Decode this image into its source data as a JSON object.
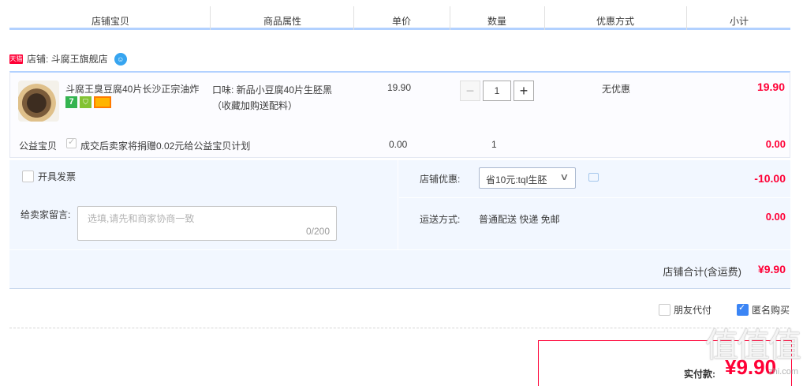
{
  "header": {
    "columns": [
      "店铺宝贝",
      "商品属性",
      "单价",
      "数量",
      "优惠方式",
      "小计"
    ]
  },
  "shop": {
    "badge": "天猫",
    "label": "店铺: 斗腐王旗舰店",
    "chat_icon": "wangwang-icon"
  },
  "item": {
    "title": "斗腐王臭豆腐40片长沙正宗油炸",
    "badges": {
      "seven": "7"
    },
    "attr_line1": "口味: 新品小豆腐40片生胚黑",
    "attr_line2": "（收藏加购送配料）",
    "price": "19.90",
    "qty": "1",
    "minus": "−",
    "plus": "+",
    "discount": "无优惠",
    "subtotal": "19.90"
  },
  "charity": {
    "label": "公益宝贝",
    "text": "成交后卖家将捐赠0.02元给公益宝贝计划",
    "price": "0.00",
    "qty": "1",
    "subtotal": "0.00"
  },
  "order": {
    "invoice": "开具发票",
    "message_label": "给卖家留言:",
    "message_placeholder": "选填,请先和商家协商一致",
    "message_count": "0/200",
    "shop_discount_label": "店铺优惠:",
    "shop_discount_select": "省10元:tql生胚",
    "shop_discount_value": "-10.00",
    "shipping_label": "运送方式:",
    "shipping_value": "普通配送 快递 免邮",
    "shipping_amount": "0.00",
    "total_label": "店铺合计(含运费)",
    "total_value": "¥9.90"
  },
  "options": {
    "friend_pay": "朋友代付",
    "anonymous": "匿名购买"
  },
  "pay": {
    "label": "实付款:",
    "value": "¥9.90"
  },
  "watermark": {
    "main": "值值值",
    "sub": "zhi.com"
  }
}
